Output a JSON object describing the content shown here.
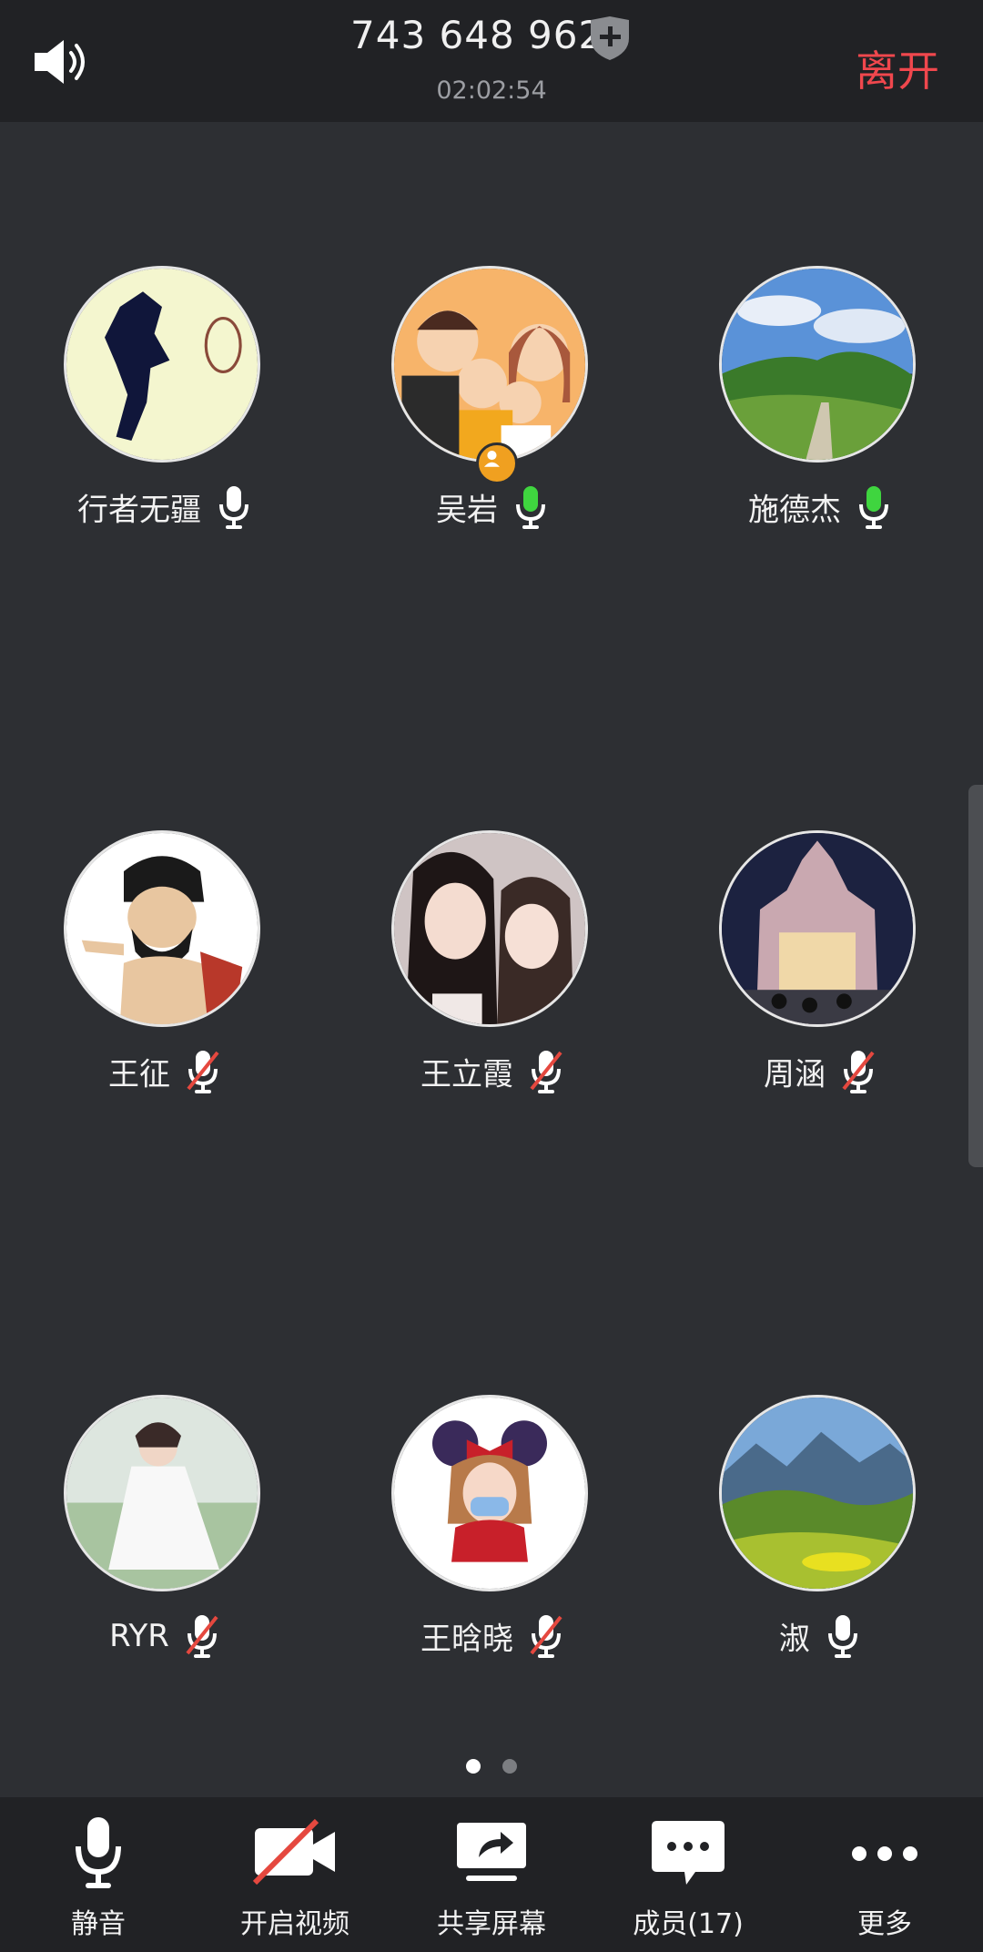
{
  "header": {
    "meeting_id": "743 648 962",
    "elapsed_time": "02:02:54",
    "leave_label": "离开",
    "speaker_icon": "speaker-icon",
    "security_icon": "shield-plus-icon"
  },
  "participants": [
    {
      "name": "行者无疆",
      "mic": "on"
    },
    {
      "name": "吴岩",
      "mic": "speaking",
      "host": true
    },
    {
      "name": "施德杰",
      "mic": "speaking"
    },
    {
      "name": "王征",
      "mic": "muted"
    },
    {
      "name": "王立霞",
      "mic": "muted"
    },
    {
      "name": "周涵",
      "mic": "muted"
    },
    {
      "name": "RYR",
      "mic": "muted"
    },
    {
      "name": "王晗晓",
      "mic": "muted"
    },
    {
      "name": "淑",
      "mic": "on"
    }
  ],
  "pagination": {
    "current": 1,
    "total": 2
  },
  "toolbar": {
    "mute_label": "静音",
    "video_label": "开启视频",
    "share_label": "共享屏幕",
    "members_label": "成员(17)",
    "more_label": "更多"
  },
  "colors": {
    "background": "#2d2f33",
    "bar": "#212225",
    "leave": "#f0474d",
    "speaking": "#3fd53f",
    "muted_slash": "#e5483f",
    "host_badge": "#f0a020"
  }
}
